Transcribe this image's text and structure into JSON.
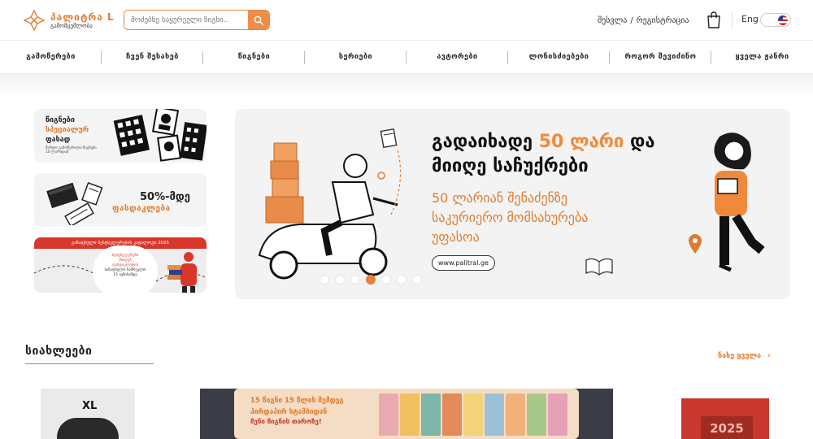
{
  "header": {
    "logo_name": "პალიტრა L",
    "logo_sub": "გამომცემლობა",
    "search_placeholder": "მოძებნე საყურეელი წიგნი..",
    "login": "შესვლა",
    "separator": "/",
    "register": "რეგისტრაცია",
    "lang": "Eng"
  },
  "nav": [
    "გამოწერები",
    "ჩვენ შესახებ",
    "წიგნები",
    "სერიები",
    "ავტორები",
    "ლონისძიებები",
    "როგორ შევიძინო",
    "ყველა ჟანრი"
  ],
  "promos": {
    "p1_line1": "წიგნები",
    "p1_line2": "სპეციალურ",
    "p1_line3": "ფასად",
    "p1_small": "მარტო გამოწერილი წიგნები",
    "p1_small2": "10 ლარიდან",
    "p2_pct": "50%-მდე",
    "p2_label": "ფასდაკლება",
    "p3_bar": "გაზაფხული ბესტსელერების კატალოგი 2025",
    "p3_t1": "ბესტსელერებს",
    "p3_t2": "მიიღებ",
    "p3_t3": "ფასდაკლებით",
    "p3_t4": "საზაფხულო სამრეკლო",
    "p3_t5": "15 ივნისამდე"
  },
  "hero": {
    "h1_a": "გადაიხადე ",
    "h1_b": "50 ლარი",
    "h1_c": " და",
    "h1_d": "მიიღე საჩუქრები",
    "sub1": "50 ლარიან შენაძენზე",
    "sub2": "საკურიერო მომსახურება",
    "sub3": "უფასოა",
    "url": "www.palitral.ge",
    "slides": 7,
    "active_slide": 4
  },
  "new_section": {
    "title": "სიახლეები",
    "see_all": "ნახე ყველა",
    "card1_label": "XL",
    "card2_line1": "15 წიგნი 15 წლის შემდეგ",
    "card2_line2": "პირდაპირ სტამბიდან",
    "card2_line3": "შენი წიგნის თაროზე!",
    "card3_year": "2025"
  },
  "colors": {
    "accent": "#e07a2e",
    "orange_button": "#ef8d48",
    "red": "#d9372b"
  }
}
